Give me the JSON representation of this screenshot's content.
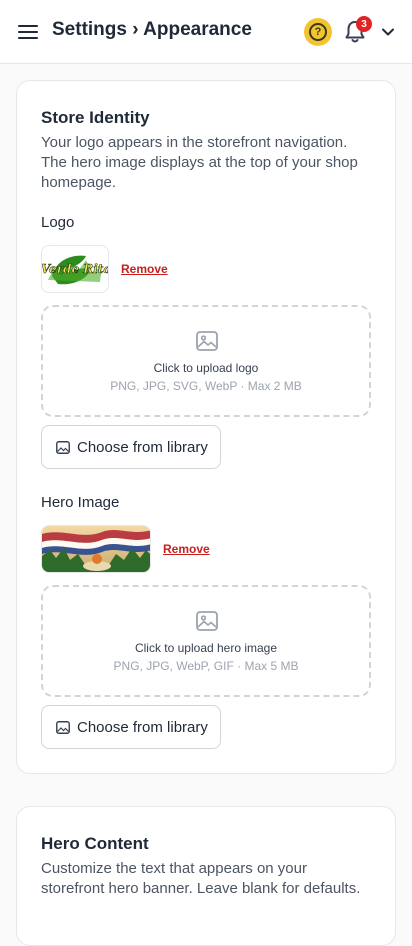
{
  "header": {
    "title": "Settings › Appearance",
    "help_label": "?",
    "notification_count": "3"
  },
  "store_identity": {
    "title": "Store Identity",
    "description": "Your logo appears in the storefront navigation. The hero image displays at the top of your shop homepage.",
    "logo": {
      "label": "Logo",
      "image_text": "Verde Rita",
      "remove_label": "Remove",
      "upload_main": "Click to upload logo",
      "upload_sub": "PNG, JPG, SVG, WebP · Max 2 MB",
      "library_label": "Choose from library"
    },
    "hero": {
      "label": "Hero Image",
      "remove_label": "Remove",
      "upload_main": "Click to upload hero image",
      "upload_sub": "PNG, JPG, WebP, GIF · Max 5 MB",
      "library_label": "Choose from library"
    }
  },
  "hero_content": {
    "title": "Hero Content",
    "description": "Customize the text that appears on your storefront hero banner. Leave blank for defaults."
  },
  "colors": {
    "accent_yellow": "#f4c430",
    "danger_red": "#c81e1e",
    "badge_red": "#e02424",
    "logo_green": "#2e8b1e"
  },
  "icons": [
    "hamburger-menu-icon",
    "help-icon",
    "bell-icon",
    "chevron-down-icon",
    "image-icon"
  ]
}
